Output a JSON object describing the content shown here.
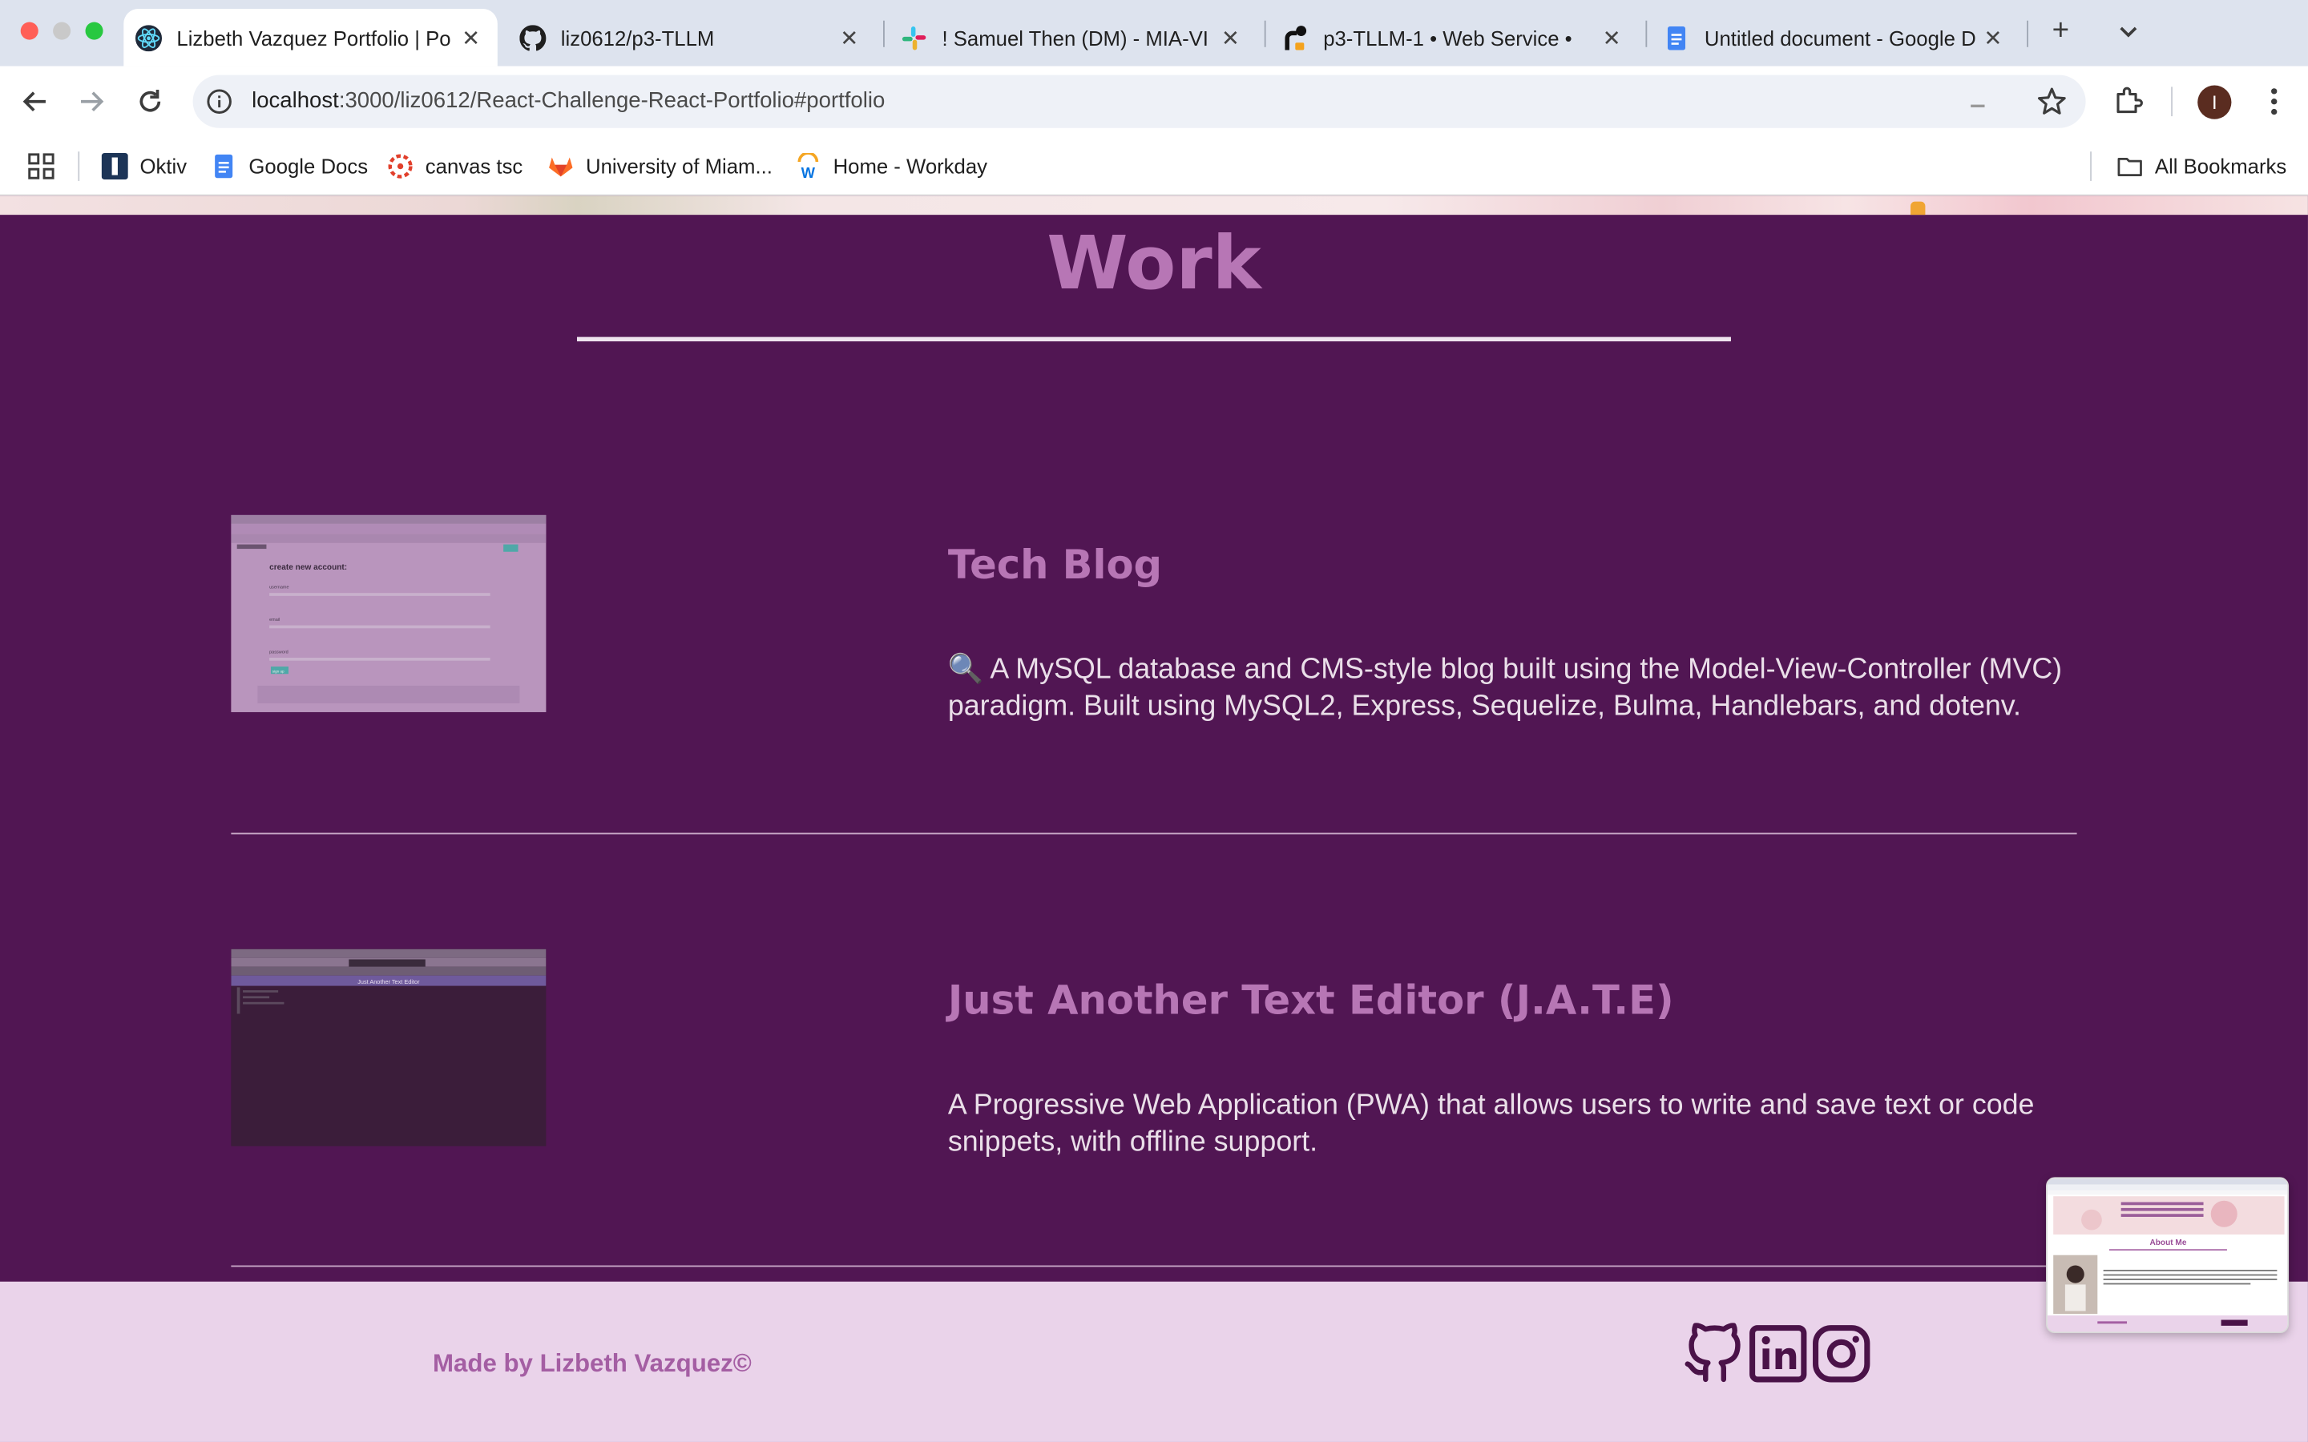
{
  "browser": {
    "tabs": [
      {
        "title": "Lizbeth Vazquez Portfolio | Po",
        "icon": "react-icon",
        "active": true
      },
      {
        "title": "liz0612/p3-TLLM",
        "icon": "github-icon",
        "active": false
      },
      {
        "title": "! Samuel Then (DM) - MIA-VI",
        "icon": "slack-icon",
        "active": false
      },
      {
        "title": "p3-TLLM-1 • Web Service •",
        "icon": "render-icon",
        "active": false
      },
      {
        "title": "Untitled document - Google D",
        "icon": "google-docs-icon",
        "active": false
      }
    ],
    "address": {
      "host": "localhost",
      "path": ":3000/liz0612/React-Challenge-React-Portfolio#portfolio"
    },
    "profile_initial": "I",
    "bookmarks": [
      {
        "label": "Oktiv",
        "icon": "oktiv-icon"
      },
      {
        "label": "Google Docs",
        "icon": "google-docs-icon"
      },
      {
        "label": "canvas tsc",
        "icon": "canvas-icon"
      },
      {
        "label": "University of Miam...",
        "icon": "gitlab-icon"
      },
      {
        "label": "Home - Workday",
        "icon": "workday-icon"
      }
    ],
    "all_bookmarks_label": "All Bookmarks"
  },
  "page": {
    "section_title": "Work",
    "projects": [
      {
        "name": "Tech Blog",
        "emoji": "🔍",
        "description": "A MySQL database and CMS-style blog built using the Model-View-Controller (MVC) paradigm. Built using MySQL2, Express, Sequelize, Bulma, Handlebars, and dotenv.",
        "thumbnail": {
          "heading": "create new account:",
          "fields": [
            "username",
            "email",
            "password"
          ],
          "button": "sign up"
        }
      },
      {
        "name": "Just Another Text Editor (J.A.T.E)",
        "emoji": "",
        "description": "A Progressive Web Application (PWA) that allows users to write and save text or code snippets, with offline support.",
        "thumbnail": {
          "heading": "Just Another Text Editor"
        }
      }
    ],
    "footer": {
      "credit": "Made by Lizbeth Vazquez©",
      "social_icons": [
        "github-icon",
        "linkedin-icon",
        "instagram-icon"
      ]
    },
    "preview": {
      "title": "About Me"
    }
  },
  "colors": {
    "page_bg": "#511653",
    "heading": "#b776b5",
    "body_text": "#eadfe9",
    "footer_bg": "#ead3ea",
    "footer_text": "#a45ea3",
    "icon": "#4a1248"
  }
}
